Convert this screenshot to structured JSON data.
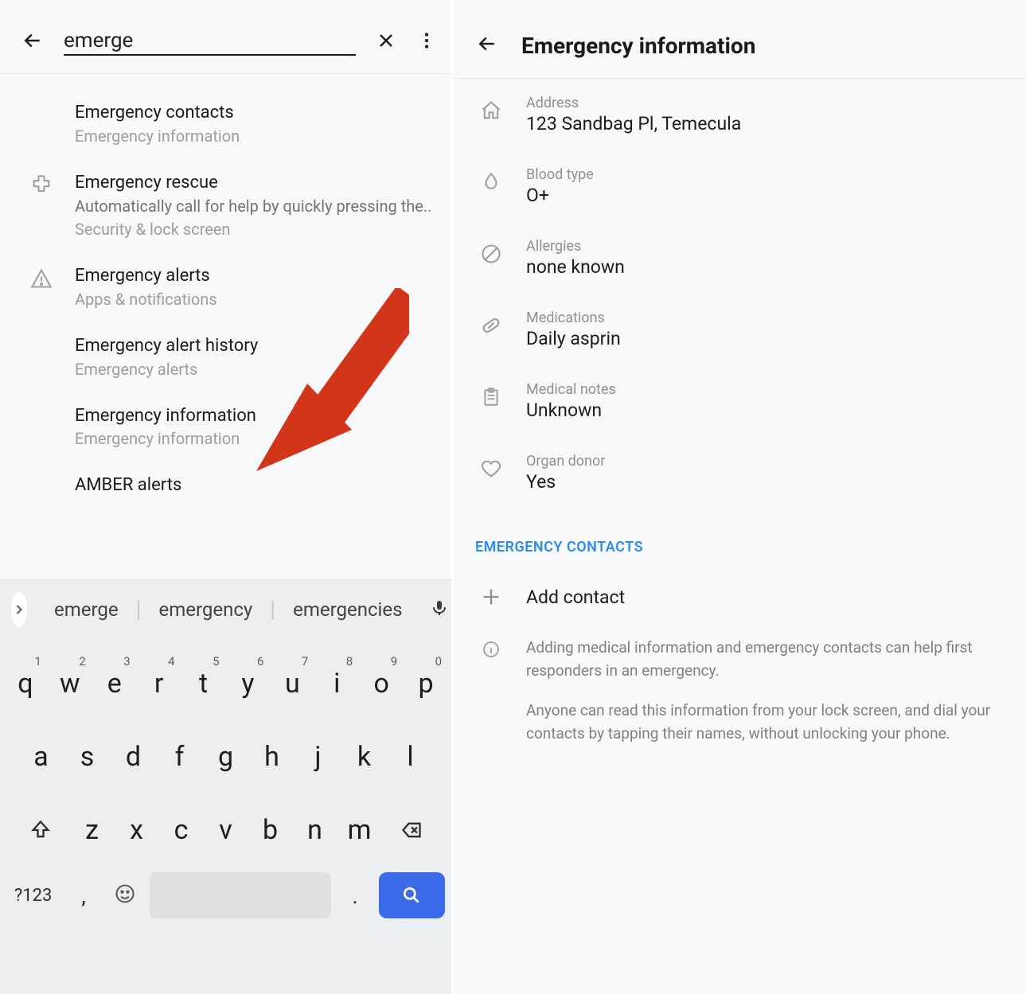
{
  "left": {
    "search_value": "emerge",
    "results": [
      {
        "icon": "",
        "title": "Emergency contacts",
        "desc": "",
        "src": "Emergency information"
      },
      {
        "icon": "medical",
        "title": "Emergency rescue",
        "desc": "Automatically call for help by quickly pressing the..",
        "src": "Security & lock screen"
      },
      {
        "icon": "alert",
        "title": "Emergency alerts",
        "desc": "",
        "src": "Apps & notifications"
      },
      {
        "icon": "",
        "title": "Emergency alert history",
        "desc": "",
        "src": "Emergency alerts"
      },
      {
        "icon": "",
        "title": "Emergency information",
        "desc": "",
        "src": "Emergency information"
      },
      {
        "icon": "",
        "title": "AMBER alerts",
        "desc": "",
        "src": ""
      }
    ],
    "suggestions": [
      "emerge",
      "emergency",
      "emergencies"
    ],
    "keyboard": {
      "row1": [
        "q",
        "w",
        "e",
        "r",
        "t",
        "y",
        "u",
        "i",
        "o",
        "p"
      ],
      "row1sup": [
        "1",
        "2",
        "3",
        "4",
        "5",
        "6",
        "7",
        "8",
        "9",
        "0"
      ],
      "row2": [
        "a",
        "s",
        "d",
        "f",
        "g",
        "h",
        "j",
        "k",
        "l"
      ],
      "row3": [
        "z",
        "x",
        "c",
        "v",
        "b",
        "n",
        "m"
      ],
      "sym": "?123",
      "comma": ",",
      "dot": "."
    }
  },
  "right": {
    "title": "Emergency information",
    "rows": [
      {
        "icon": "home",
        "label": "Address",
        "value": "123 Sandbag Pl, Temecula"
      },
      {
        "icon": "drop",
        "label": "Blood type",
        "value": "O+"
      },
      {
        "icon": "none",
        "label": "Allergies",
        "value": "none known"
      },
      {
        "icon": "pill",
        "label": "Medications",
        "value": "Daily asprin"
      },
      {
        "icon": "clip",
        "label": "Medical notes",
        "value": "Unknown"
      },
      {
        "icon": "heart",
        "label": "Organ donor",
        "value": "Yes"
      }
    ],
    "section": "EMERGENCY CONTACTS",
    "add": "Add contact",
    "note1": "Adding medical information and emergency contacts can help first responders in an emergency.",
    "note2": "Anyone can read this information from your lock screen, and dial your contacts by tapping their names, without unlocking your phone."
  }
}
